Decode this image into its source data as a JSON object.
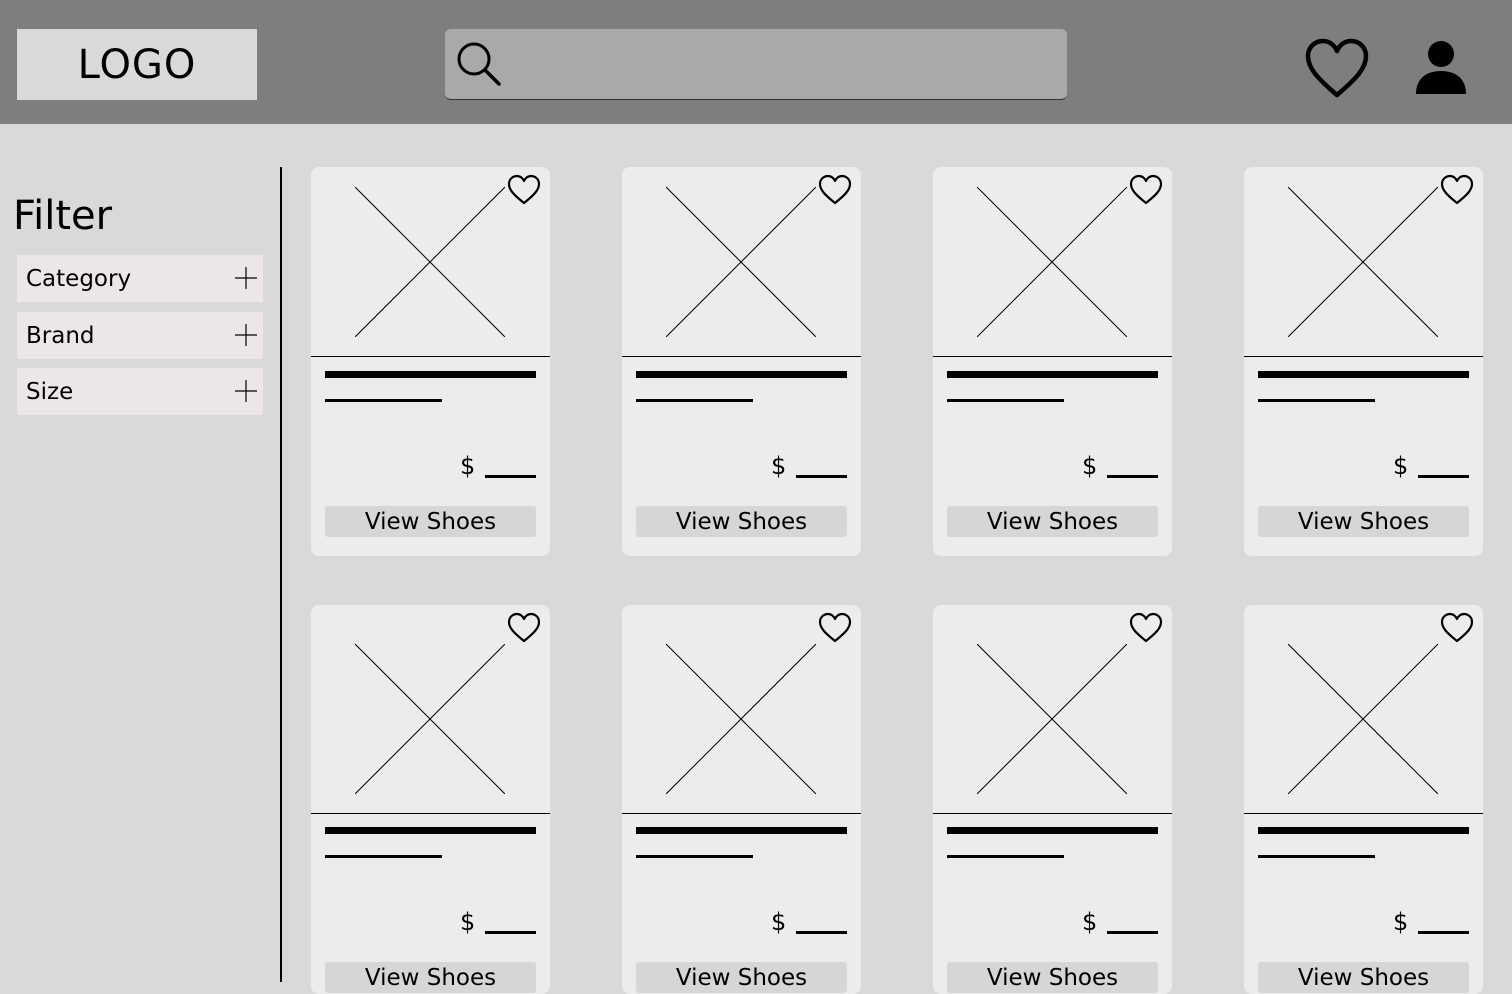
{
  "header": {
    "logo": "LOGO",
    "search_placeholder": "",
    "icons": [
      "search-icon",
      "heart-icon",
      "user-icon"
    ]
  },
  "sidebar": {
    "title": "Filter",
    "filters": [
      {
        "label": "Category",
        "icon": "plus-icon"
      },
      {
        "label": "Brand",
        "icon": "plus-icon"
      },
      {
        "label": "Size",
        "icon": "plus-icon"
      }
    ]
  },
  "products": [
    {
      "currency": "$",
      "button": "View Shoes"
    },
    {
      "currency": "$",
      "button": "View Shoes"
    },
    {
      "currency": "$",
      "button": "View Shoes"
    },
    {
      "currency": "$",
      "button": "View Shoes"
    },
    {
      "currency": "$",
      "button": "View Shoes"
    },
    {
      "currency": "$",
      "button": "View Shoes"
    },
    {
      "currency": "$",
      "button": "View Shoes"
    },
    {
      "currency": "$",
      "button": "View Shoes"
    }
  ],
  "colors": {
    "header_bg": "#7e7e7e",
    "page_bg": "#d9d9d9",
    "card_bg": "#ececec",
    "search_bg": "#a9a9a9",
    "filter_bg": "#ece6e6"
  }
}
